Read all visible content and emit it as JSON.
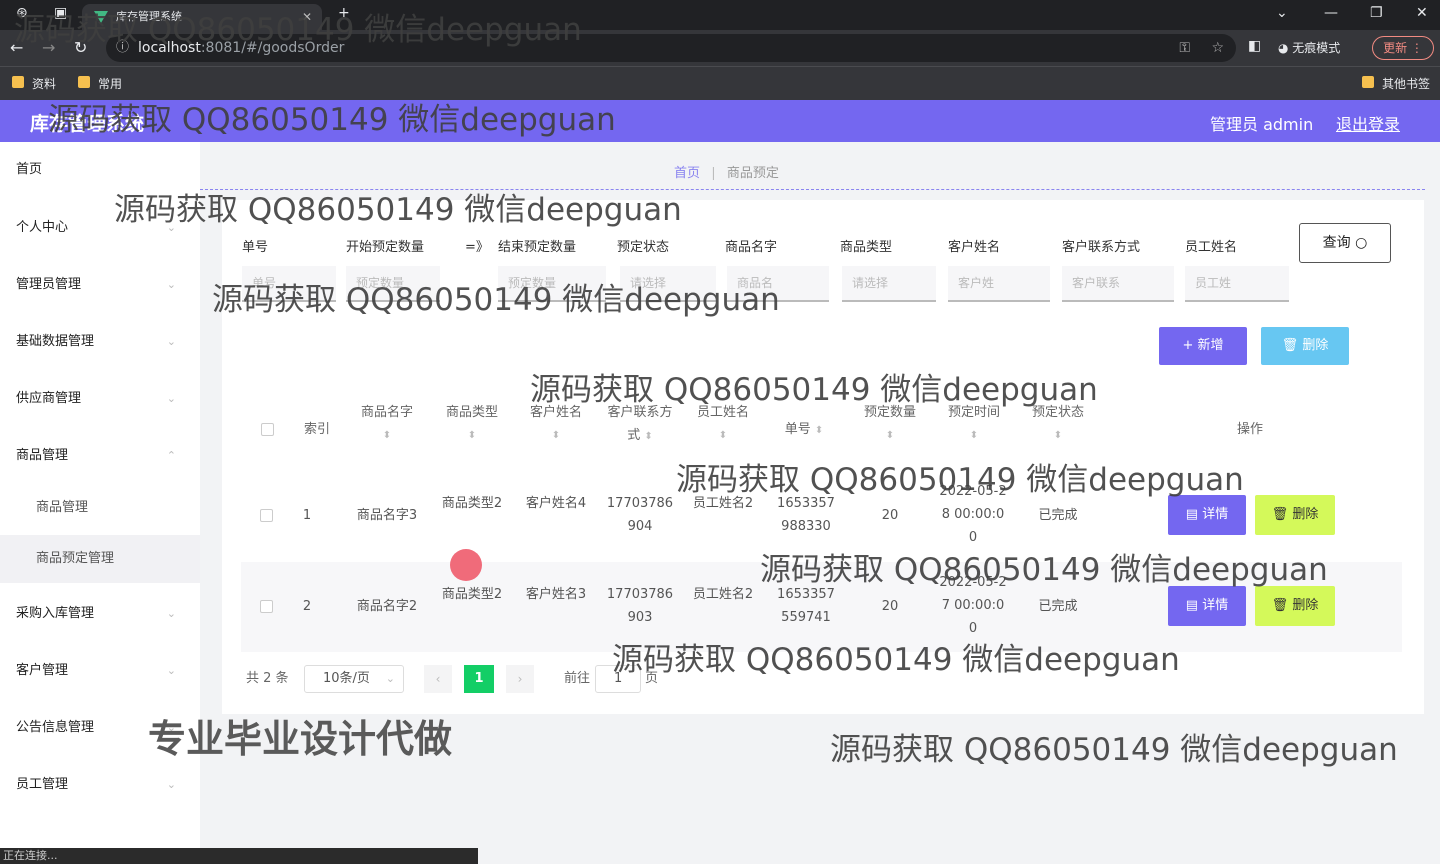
{
  "browser": {
    "tab_title": "库存管理系统",
    "url_host": "localhost",
    "url_rest": ":8081/#/goodsOrder",
    "incognito_label": "无痕模式",
    "update_label": "更新",
    "bookmarks": [
      "资料",
      "常用",
      "其他书签"
    ],
    "status": "正在连接..."
  },
  "header": {
    "title": "库存管理系统",
    "admin": "管理员 admin",
    "logout": "退出登录"
  },
  "sidebar": {
    "items": [
      "首页",
      "个人中心",
      "管理员管理",
      "基础数据管理",
      "供应商管理",
      "商品管理",
      "商品管理",
      "商品预定管理",
      "采购入库管理",
      "客户管理",
      "公告信息管理",
      "员工管理"
    ]
  },
  "breadcrumb": {
    "home": "首页",
    "current": "商品预定"
  },
  "search": {
    "labels": [
      "单号",
      "开始预定数量",
      "=》",
      "结束预定数量",
      "预定状态",
      "商品名字",
      "商品类型",
      "客户姓名",
      "客户联系方式",
      "员工姓名"
    ],
    "placeholders": [
      "单号",
      "预定数量",
      "预定数量",
      "请选择",
      "商品名",
      "请选择",
      "客户姓",
      "客户联系",
      "员工姓"
    ],
    "query": "查询"
  },
  "actions": {
    "add": "新增",
    "delete": "删除"
  },
  "table": {
    "headers": [
      "索引",
      "商品名字",
      "商品类型",
      "客户姓名",
      "客户联系方式",
      "员工姓名",
      "单号",
      "预定数量",
      "预定时间",
      "预定状态",
      "操作"
    ],
    "rows": [
      {
        "index": "1",
        "goods_name": "商品名字3",
        "goods_type": "商品类型2",
        "customer": "客户姓名4",
        "phone": "17703786904",
        "employee": "员工姓名2",
        "order_no": "1653357988330",
        "qty": "20",
        "time": "2022-05-28 00:00:00",
        "status": "已完成",
        "detail": "详情",
        "delete": "删除"
      },
      {
        "index": "2",
        "goods_name": "商品名字2",
        "goods_type": "商品类型2",
        "customer": "客户姓名3",
        "phone": "17703786903",
        "employee": "员工姓名2",
        "order_no": "1653357559741",
        "qty": "20",
        "time": "2022-05-27 00:00:00",
        "status": "已完成",
        "detail": "详情",
        "delete": "删除"
      }
    ]
  },
  "pagination": {
    "total": "共 2 条",
    "size": "10条/页",
    "current": "1",
    "goto": "前往",
    "goto_value": "1",
    "page_suffix": "页"
  },
  "watermarks": [
    "源码获取 QQ86050149 微信deepguan",
    "专业毕业设计代做"
  ]
}
